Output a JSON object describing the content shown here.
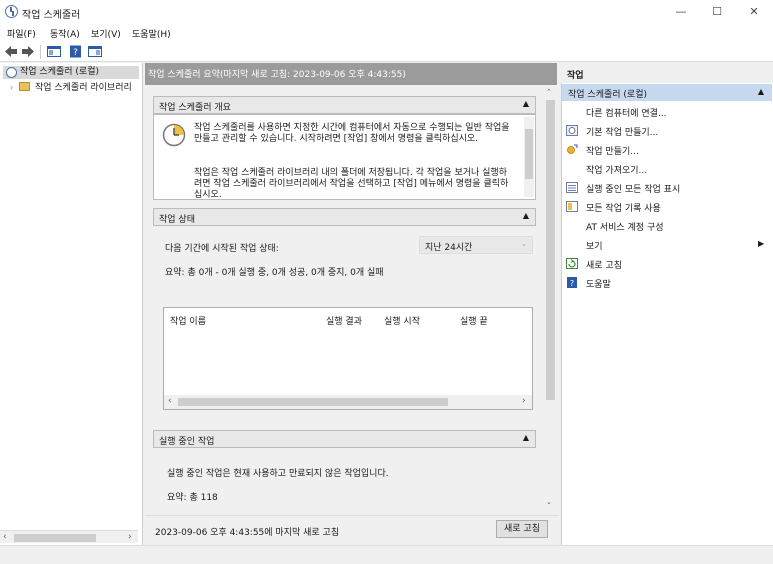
{
  "window": {
    "title": "작업 스케줄러",
    "minimize": "—",
    "maximize": "☐",
    "close": "✕"
  },
  "menu": [
    "파일(F)",
    "동작(A)",
    "보기(V)",
    "도움말(H)"
  ],
  "toolbar": [
    "back-icon",
    "forward-icon",
    "console-tree-icon",
    "help-icon",
    "action-pane-icon"
  ],
  "tree": {
    "root": "작업 스케줄러 (로컬)",
    "child": "작업 스케줄러 라이브러리"
  },
  "center": {
    "header": "작업 스케줄러 요약(마지막 새로 고침: 2023-09-06 오후 4:43:55)",
    "overview": {
      "title": "작업 스케줄러 개요",
      "p1": "작업 스케줄러를 사용하면 지정한 시간에 컴퓨터에서 자동으로 수행되는 일반 작업을 만들고 관리할 수 있습니다. 시작하려면 [작업] 창에서 명령을 클릭하십시오.",
      "p2": "작업은 작업 스케줄러 라이브러리 내의 폴더에 저장됩니다. 각 작업을 보거나 실행하려면 작업 스케줄러 라이브러리에서 작업을 선택하고 [작업] 메뉴에서 명령을 클릭하십시오."
    },
    "status": {
      "title": "작업 상태",
      "label": "다음 기간에 시작된 작업 상태:",
      "period": "지난 24시간",
      "summary": "요약: 총 0개 - 0개 실행 중, 0개 성공, 0개 중지, 0개 실패",
      "columns": [
        "작업 이름",
        "실행 결과",
        "실행 시작",
        "실행 끝"
      ]
    },
    "running": {
      "title": "실행 중인 작업",
      "text": "실행 중인 작업은 현재 사용하고 만료되지 않은 작업입니다.",
      "summary": "요약: 총 118"
    },
    "footer": "2023-09-06 오후 4:43:55에 마지막 새로 고침",
    "refresh": "새로 고침"
  },
  "actions": {
    "header": "작업",
    "selected": "작업 스케줄러 (로컬)",
    "items": [
      {
        "label": "다른 컴퓨터에 연결...",
        "icon": ""
      },
      {
        "label": "기본 작업 만들기...",
        "icon": "basic-task-icon"
      },
      {
        "label": "작업 만들기...",
        "icon": "create-task-icon"
      },
      {
        "label": "작업 가져오기...",
        "icon": ""
      },
      {
        "label": "실행 중인 모든 작업 표시",
        "icon": "running-tasks-icon"
      },
      {
        "label": "모든 작업 기록 사용",
        "icon": "history-icon"
      },
      {
        "label": "AT 서비스 계정 구성",
        "icon": ""
      },
      {
        "label": "보기",
        "icon": ""
      },
      {
        "label": "새로 고침",
        "icon": "refresh-icon"
      },
      {
        "label": "도움말",
        "icon": "help-icon"
      }
    ]
  }
}
